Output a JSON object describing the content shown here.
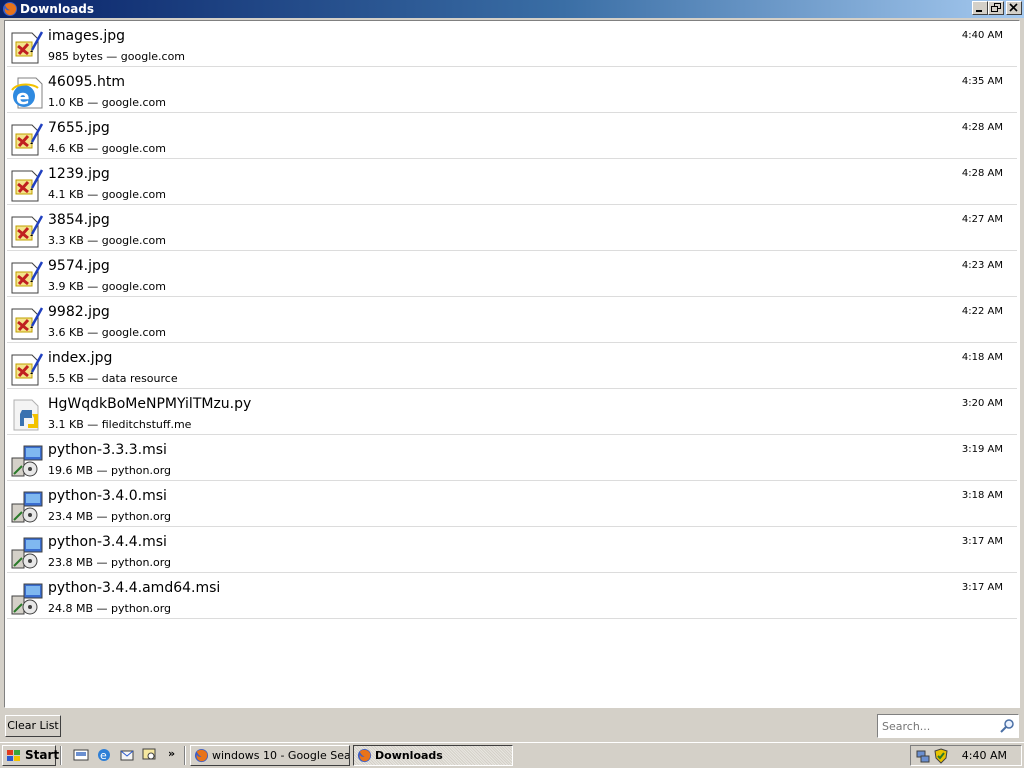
{
  "window": {
    "title": "Downloads",
    "icon": "firefox-icon"
  },
  "downloads": [
    {
      "name": "images.jpg",
      "detail": "985 bytes — google.com",
      "time": "4:40 AM",
      "icon": "image-file-icon"
    },
    {
      "name": "46095.htm",
      "detail": "1.0 KB — google.com",
      "time": "4:35 AM",
      "icon": "html-file-icon"
    },
    {
      "name": "7655.jpg",
      "detail": "4.6 KB — google.com",
      "time": "4:28 AM",
      "icon": "image-file-icon"
    },
    {
      "name": "1239.jpg",
      "detail": "4.1 KB — google.com",
      "time": "4:28 AM",
      "icon": "image-file-icon"
    },
    {
      "name": "3854.jpg",
      "detail": "3.3 KB — google.com",
      "time": "4:27 AM",
      "icon": "image-file-icon"
    },
    {
      "name": "9574.jpg",
      "detail": "3.9 KB — google.com",
      "time": "4:23 AM",
      "icon": "image-file-icon"
    },
    {
      "name": "9982.jpg",
      "detail": "3.6 KB — google.com",
      "time": "4:22 AM",
      "icon": "image-file-icon"
    },
    {
      "name": "index.jpg",
      "detail": "5.5 KB — data resource",
      "time": "4:18 AM",
      "icon": "image-file-icon"
    },
    {
      "name": "HgWqdkBoMeNPMYilTMzu.py",
      "detail": "3.1 KB — fileditchstuff.me",
      "time": "3:20 AM",
      "icon": "python-file-icon"
    },
    {
      "name": "python-3.3.3.msi",
      "detail": "19.6 MB — python.org",
      "time": "3:19 AM",
      "icon": "installer-file-icon"
    },
    {
      "name": "python-3.4.0.msi",
      "detail": "23.4 MB — python.org",
      "time": "3:18 AM",
      "icon": "installer-file-icon"
    },
    {
      "name": "python-3.4.4.msi",
      "detail": "23.8 MB — python.org",
      "time": "3:17 AM",
      "icon": "installer-file-icon"
    },
    {
      "name": "python-3.4.4.amd64.msi",
      "detail": "24.8 MB — python.org",
      "time": "3:17 AM",
      "icon": "installer-file-icon"
    }
  ],
  "footer": {
    "clear_label": "Clear List",
    "search_placeholder": "Search..."
  },
  "taskbar": {
    "start_label": "Start",
    "tasks": [
      {
        "label": "windows 10 - Google Sear...",
        "icon": "firefox-icon",
        "active": false
      },
      {
        "label": "Downloads",
        "icon": "firefox-icon",
        "active": true
      }
    ],
    "quicklaunch_more": "»",
    "clock": "4:40 AM"
  }
}
